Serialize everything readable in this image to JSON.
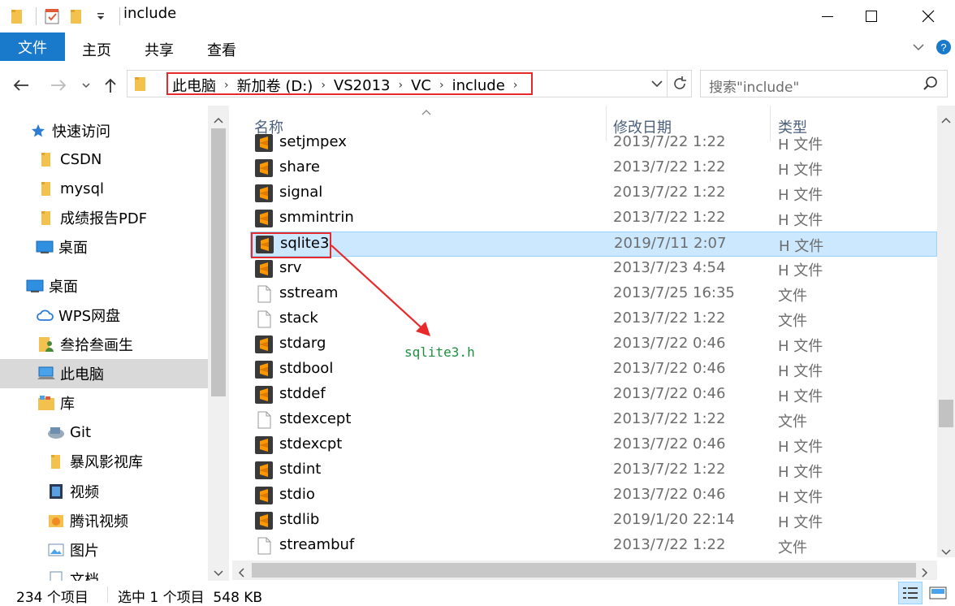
{
  "window": {
    "title": "include",
    "minimize": "—",
    "maximize": "☐",
    "close": "✕"
  },
  "ribbon": {
    "file": "文件",
    "tabs": [
      "主页",
      "共享",
      "查看"
    ]
  },
  "address": {
    "crumbs": [
      "此电脑",
      "新加卷 (D:)",
      "VS2013",
      "VC",
      "include"
    ],
    "separator": "›"
  },
  "search": {
    "placeholder": "搜索\"include\""
  },
  "sidebar": {
    "items": [
      {
        "label": "快速访问",
        "icon": "star-icon"
      },
      {
        "label": "CSDN",
        "icon": "folder-icon"
      },
      {
        "label": "mysql",
        "icon": "folder-icon"
      },
      {
        "label": "成绩报告PDF",
        "icon": "folder-icon"
      },
      {
        "label": "桌面",
        "icon": "desktop-icon"
      },
      {
        "label": "桌面",
        "icon": "desktop-icon"
      },
      {
        "label": "WPS网盘",
        "icon": "cloud-icon"
      },
      {
        "label": "叁拾叁画生",
        "icon": "user-folder-icon"
      },
      {
        "label": "此电脑",
        "icon": "computer-icon"
      },
      {
        "label": "库",
        "icon": "library-icon"
      },
      {
        "label": "Git",
        "icon": "git-icon"
      },
      {
        "label": "暴风影视库",
        "icon": "folder-icon"
      },
      {
        "label": "视频",
        "icon": "video-icon"
      },
      {
        "label": "腾讯视频",
        "icon": "tencent-video-icon"
      },
      {
        "label": "图片",
        "icon": "pictures-icon"
      },
      {
        "label": "文档",
        "icon": "documents-icon"
      }
    ]
  },
  "columns": {
    "name": "名称",
    "date": "修改日期",
    "type": "类型"
  },
  "files": [
    {
      "name": "setjmpex",
      "date": "2013/7/22 1:22",
      "type": "H 文件",
      "icon": "sublime-icon"
    },
    {
      "name": "share",
      "date": "2013/7/22 1:22",
      "type": "H 文件",
      "icon": "sublime-icon"
    },
    {
      "name": "signal",
      "date": "2013/7/22 1:22",
      "type": "H 文件",
      "icon": "sublime-icon"
    },
    {
      "name": "smmintrin",
      "date": "2013/7/22 1:22",
      "type": "H 文件",
      "icon": "sublime-icon"
    },
    {
      "name": "sqlite3",
      "date": "2019/7/11 2:07",
      "type": "H 文件",
      "icon": "sublime-icon",
      "selected": true
    },
    {
      "name": "srv",
      "date": "2013/7/23 4:54",
      "type": "H 文件",
      "icon": "sublime-icon"
    },
    {
      "name": "sstream",
      "date": "2013/7/25 16:35",
      "type": "文件",
      "icon": "blank-file-icon"
    },
    {
      "name": "stack",
      "date": "2013/7/22 1:22",
      "type": "文件",
      "icon": "blank-file-icon"
    },
    {
      "name": "stdarg",
      "date": "2013/7/22 0:46",
      "type": "H 文件",
      "icon": "sublime-icon"
    },
    {
      "name": "stdbool",
      "date": "2013/7/22 0:46",
      "type": "H 文件",
      "icon": "sublime-icon"
    },
    {
      "name": "stddef",
      "date": "2013/7/22 0:46",
      "type": "H 文件",
      "icon": "sublime-icon"
    },
    {
      "name": "stdexcept",
      "date": "2013/7/22 1:22",
      "type": "文件",
      "icon": "blank-file-icon"
    },
    {
      "name": "stdexcpt",
      "date": "2013/7/22 0:46",
      "type": "H 文件",
      "icon": "sublime-icon"
    },
    {
      "name": "stdint",
      "date": "2013/7/22 1:22",
      "type": "H 文件",
      "icon": "sublime-icon"
    },
    {
      "name": "stdio",
      "date": "2013/7/22 0:46",
      "type": "H 文件",
      "icon": "sublime-icon"
    },
    {
      "name": "stdlib",
      "date": "2019/1/20 22:14",
      "type": "H 文件",
      "icon": "sublime-icon"
    },
    {
      "name": "streambuf",
      "date": "2013/7/22 1:22",
      "type": "文件",
      "icon": "blank-file-icon"
    }
  ],
  "annotation": {
    "text": "sqlite3.h",
    "color": "#1e8f3e",
    "highlight_color": "#e8292c"
  },
  "status": {
    "count": "234 个项目",
    "selection": "选中 1 个项目  548 KB"
  },
  "colors": {
    "file_tab": "#1979ca",
    "selection_bg": "#cce8ff",
    "sidebar_selected": "#d9d9d9"
  }
}
